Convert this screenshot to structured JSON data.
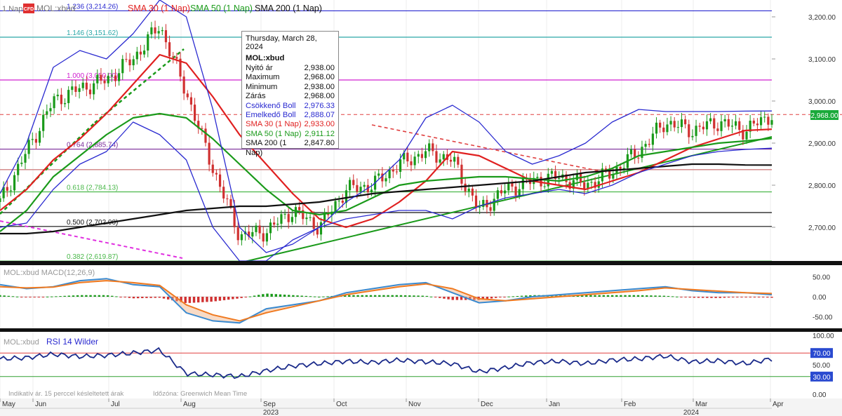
{
  "header": {
    "symbol_prefix": "1 Nap",
    "cfd_badge": "CFD",
    "symbol": "MOL:xbud",
    "legend": [
      {
        "label": "SMA 30 (1 Nap)",
        "color": "#e02020"
      },
      {
        "label": "SMA 50 (1 Nap)",
        "color": "#1a9a1a"
      },
      {
        "label": "SMA 200 (1 Nap)",
        "color": "#111111"
      }
    ]
  },
  "tooltip": {
    "date": "Thursday, March 28, 2024",
    "symbol": "MOL:xbud",
    "rows": [
      {
        "label": "Nyitó ár",
        "value": "2,938.00",
        "color": "#111111"
      },
      {
        "label": "Maximum",
        "value": "2,968.00",
        "color": "#111111"
      },
      {
        "label": "Minimum",
        "value": "2,938.00",
        "color": "#111111"
      },
      {
        "label": "Zárás",
        "value": "2,968.00",
        "color": "#111111"
      },
      {
        "label": "Csökkenő Boll",
        "value": "2,976.33",
        "color": "#2a2ad0"
      },
      {
        "label": "Emelkedő Boll",
        "value": "2,888.07",
        "color": "#2a2ad0"
      },
      {
        "label": "SMA 30 (1 Nap)",
        "value": "2,933.00",
        "color": "#e02020"
      },
      {
        "label": "SMA 50 (1 Nap)",
        "value": "2,911.12",
        "color": "#1a9a1a"
      },
      {
        "label": "SMA 200 (1 Nap)",
        "value": "2,847.80",
        "color": "#111111"
      }
    ]
  },
  "chart_data": [
    {
      "type": "line",
      "panel": "price",
      "y_axis_ticks": [
        "3,200.00",
        "3,100.00",
        "3,000.00",
        "2,900.00",
        "2,800.00",
        "2,700.00"
      ],
      "ylim": [
        2620,
        3240
      ],
      "current_price_label": "2,968.00",
      "x_ticks": [
        "May",
        "Jun",
        "Jul",
        "Aug",
        "Sep",
        "Oct",
        "Nov",
        "Dec",
        "Jan",
        "Feb",
        "Mar",
        "Apr"
      ],
      "year_labels": [
        "2023",
        "2024"
      ],
      "fibonacci_levels": [
        {
          "label": "1.236 (3,214.26)",
          "value": 3214.26,
          "color": "#2a2ad0"
        },
        {
          "label": "1.146 (3,151.62)",
          "value": 3151.62,
          "color": "#2aa8a8"
        },
        {
          "label": "1.000 (3,050.00)",
          "value": 3050.0,
          "color": "#d020d0"
        },
        {
          "label": "0.764 (2,885.74)",
          "value": 2885.74,
          "color": "#7a2a9a"
        },
        {
          "label": "0.618 (2,784.13)",
          "value": 2784.13,
          "color": "#4ab84a"
        },
        {
          "label": "0.500 (2,702.00)",
          "value": 2702.0,
          "color": "#111111"
        },
        {
          "label": "0.382 (2,619.87)",
          "value": 2619.87,
          "color": "#4ab84a"
        }
      ],
      "horizontal_levels": [
        2968,
        2837,
        2735
      ],
      "series": [
        {
          "name": "SMA 30 (1 Nap)",
          "color": "#e02020",
          "values": [
            2740,
            2790,
            2860,
            2910,
            2970,
            3040,
            3110,
            3090,
            3010,
            2920,
            2850,
            2780,
            2720,
            2700,
            2720,
            2760,
            2810,
            2880,
            2870,
            2840,
            2810,
            2800,
            2790,
            2810,
            2830,
            2860,
            2890,
            2910,
            2930,
            2933
          ]
        },
        {
          "name": "SMA 50 (1 Nap)",
          "color": "#1a9a1a",
          "values": [
            2690,
            2740,
            2820,
            2870,
            2920,
            2960,
            2970,
            2960,
            2910,
            2850,
            2790,
            2740,
            2730,
            2740,
            2770,
            2800,
            2810,
            2815,
            2820,
            2820,
            2815,
            2810,
            2820,
            2840,
            2870,
            2880,
            2890,
            2900,
            2905,
            2911.12
          ]
        },
        {
          "name": "SMA 200 (1 Nap)",
          "color": "#111111",
          "values": [
            2685,
            2685,
            2690,
            2700,
            2710,
            2720,
            2730,
            2740,
            2745,
            2750,
            2750,
            2755,
            2760,
            2770,
            2780,
            2785,
            2790,
            2795,
            2800,
            2805,
            2810,
            2820,
            2830,
            2835,
            2840,
            2845,
            2850,
            2850,
            2848,
            2847.8
          ]
        },
        {
          "name": "Csökkenő Boll",
          "color": "#2a2ad0",
          "values": [
            2780,
            2900,
            3080,
            3120,
            3100,
            3160,
            3240,
            3200,
            2980,
            2700,
            2640,
            2660,
            2700,
            2760,
            2800,
            2860,
            2960,
            2990,
            2950,
            2880,
            2850,
            2870,
            2900,
            2950,
            2980,
            2975,
            2975,
            2975,
            2976,
            2976.33
          ]
        },
        {
          "name": "Emelkedő Boll",
          "color": "#2a2ad0",
          "values": [
            2700,
            2710,
            2790,
            2850,
            2880,
            2950,
            2920,
            2860,
            2700,
            2620,
            2620,
            2670,
            2700,
            2720,
            2730,
            2740,
            2740,
            2720,
            2750,
            2770,
            2780,
            2790,
            2780,
            2800,
            2830,
            2850,
            2870,
            2880,
            2885,
            2888.07
          ]
        },
        {
          "name": "Zárás",
          "color": "#1a9a1a",
          "values": [
            2760,
            2880,
            3000,
            3030,
            3050,
            3100,
            3180,
            3020,
            2840,
            2680,
            2690,
            2740,
            2700,
            2790,
            2800,
            2850,
            2880,
            2860,
            2740,
            2790,
            2810,
            2820,
            2800,
            2830,
            2880,
            2950,
            2930,
            2950,
            2930,
            2968
          ]
        }
      ]
    },
    {
      "type": "line",
      "panel": "macd",
      "label": "MOL:xbud MACD(12,26,9)",
      "y_axis_ticks": [
        "50.00",
        "0.00",
        "-50.00"
      ],
      "ylim": [
        -75,
        75
      ],
      "series": [
        {
          "name": "MACD",
          "color": "#3a8ad0",
          "values": [
            30,
            20,
            25,
            40,
            45,
            30,
            25,
            -40,
            -60,
            -65,
            -30,
            -20,
            -10,
            10,
            20,
            30,
            35,
            10,
            -15,
            -10,
            0,
            5,
            10,
            15,
            20,
            25,
            15,
            10,
            10,
            5
          ]
        },
        {
          "name": "Signal",
          "color": "#f07a20",
          "values": [
            25,
            22,
            24,
            35,
            40,
            35,
            28,
            -20,
            -45,
            -60,
            -40,
            -25,
            -10,
            5,
            15,
            25,
            32,
            20,
            -5,
            -10,
            -5,
            0,
            5,
            10,
            15,
            22,
            18,
            14,
            10,
            8
          ]
        }
      ]
    },
    {
      "type": "line",
      "panel": "rsi",
      "label": "RSI 14 Wilder",
      "y_axis_ticks": [
        "100.00",
        "70.00",
        "50.00",
        "30.00",
        "0.00"
      ],
      "ylim": [
        0,
        100
      ],
      "levels": [
        {
          "value": "70.00",
          "color": "#e04040"
        },
        {
          "value": "30.00",
          "color": "#30a030"
        }
      ],
      "series": [
        {
          "name": "RSI 14 Wilder",
          "color": "#1a2a8a",
          "values": [
            60,
            62,
            68,
            64,
            66,
            70,
            75,
            35,
            33,
            30,
            40,
            48,
            52,
            56,
            54,
            58,
            55,
            52,
            38,
            45,
            54,
            56,
            52,
            58,
            60,
            65,
            55,
            57,
            52,
            60
          ]
        }
      ]
    }
  ],
  "footer": {
    "note": "Indikatív ár. 15 perccel késleltetett árak",
    "timezone": "Időzóna: Greenwich Mean Time"
  }
}
